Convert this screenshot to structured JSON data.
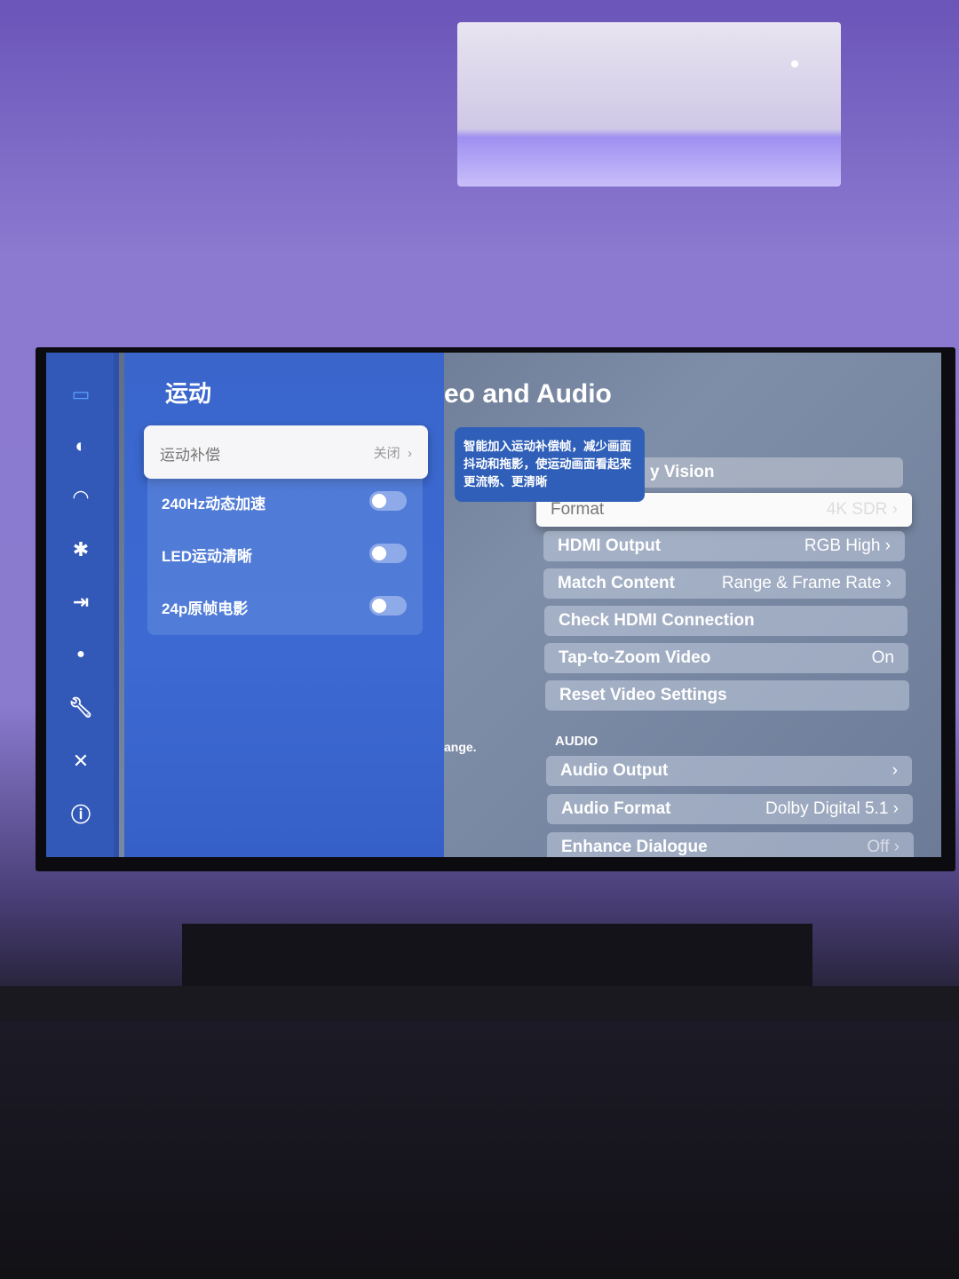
{
  "sidebar": {
    "icons": [
      "picture-icon",
      "sound-icon",
      "wifi-icon",
      "bluetooth-icon",
      "input-icon",
      "ai-icon",
      "wrench-icon",
      "tools-icon",
      "info-icon"
    ]
  },
  "motion_panel": {
    "title": "运动",
    "selected": {
      "label": "运动补偿",
      "value": "关闭"
    },
    "toggles": [
      {
        "label": "240Hz动态加速",
        "on": false
      },
      {
        "label": "LED运动清晰",
        "on": false
      },
      {
        "label": "24p原帧电影",
        "on": false
      }
    ]
  },
  "tooltip": "智能加入运动补偿帧，减少画面抖动和拖影，使运动画面看起来更流畅、更清晰",
  "settings": {
    "title": "eo and Audio",
    "side_hint": "ange.",
    "video_items": [
      {
        "label": "y Vision",
        "value": ""
      },
      {
        "label": "Format",
        "value": "4K SDR",
        "chevron": true
      },
      {
        "label": "HDMI Output",
        "value": "RGB High",
        "chevron": true
      },
      {
        "label": "Match Content",
        "value": "Range & Frame Rate",
        "chevron": true
      },
      {
        "label": "Check HDMI Connection",
        "value": ""
      },
      {
        "label": "Tap-to-Zoom Video",
        "value": "On"
      },
      {
        "label": "Reset Video Settings",
        "value": ""
      }
    ],
    "audio_header": "AUDIO",
    "audio_items": [
      {
        "label": "Audio Output",
        "value": "",
        "chevron": true
      },
      {
        "label": "Audio Format",
        "value": "Dolby Digital 5.1",
        "chevron": true
      },
      {
        "label": "Enhance Dialogue",
        "value": "Off",
        "chevron": true
      }
    ]
  },
  "colors": {
    "rail": "#3258b8",
    "panel": "#3a66cc",
    "tooltip": "#2f5fb8"
  }
}
